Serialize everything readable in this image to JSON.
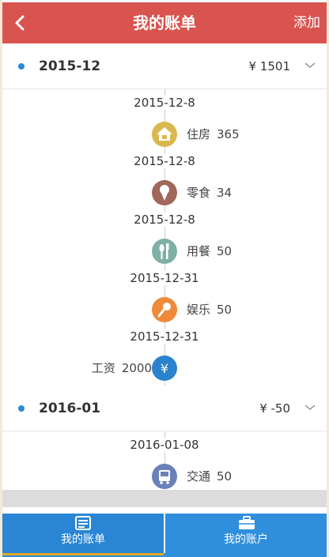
{
  "header": {
    "title": "我的账单",
    "add_label": "添加"
  },
  "months": [
    {
      "month": "2015-12",
      "total": "¥ 1501",
      "entries": [
        {
          "date": "2015-12-8",
          "category": "住房",
          "amount": "365",
          "icon": "house-icon",
          "color": "#d9b84f"
        },
        {
          "date": "2015-12-8",
          "category": "零食",
          "amount": "34",
          "icon": "ice-cream-icon",
          "color": "#a0675a"
        },
        {
          "date": "2015-12-8",
          "category": "用餐",
          "amount": "50",
          "icon": "cutlery-icon",
          "color": "#7fb0a6"
        },
        {
          "date": "2015-12-31",
          "category": "娱乐",
          "amount": "50",
          "icon": "microphone-icon",
          "color": "#ee8a3a"
        },
        {
          "date": "2015-12-31",
          "category": "工资",
          "amount": "2000",
          "icon": "yuan-icon",
          "color": "#2a83cc"
        }
      ]
    },
    {
      "month": "2016-01",
      "total": "¥ -50",
      "entries": [
        {
          "date": "2016-01-08",
          "category": "交通",
          "amount": "50",
          "icon": "bus-icon",
          "color": "#6a80b8"
        }
      ]
    }
  ],
  "tabs": {
    "bills": "我的账单",
    "accounts": "我的账户"
  },
  "colors": {
    "header": "#d9534f",
    "tabbar": "#2f8fdc",
    "accent_dot": "#2a89d4",
    "tab_indicator": "#e6a623"
  }
}
